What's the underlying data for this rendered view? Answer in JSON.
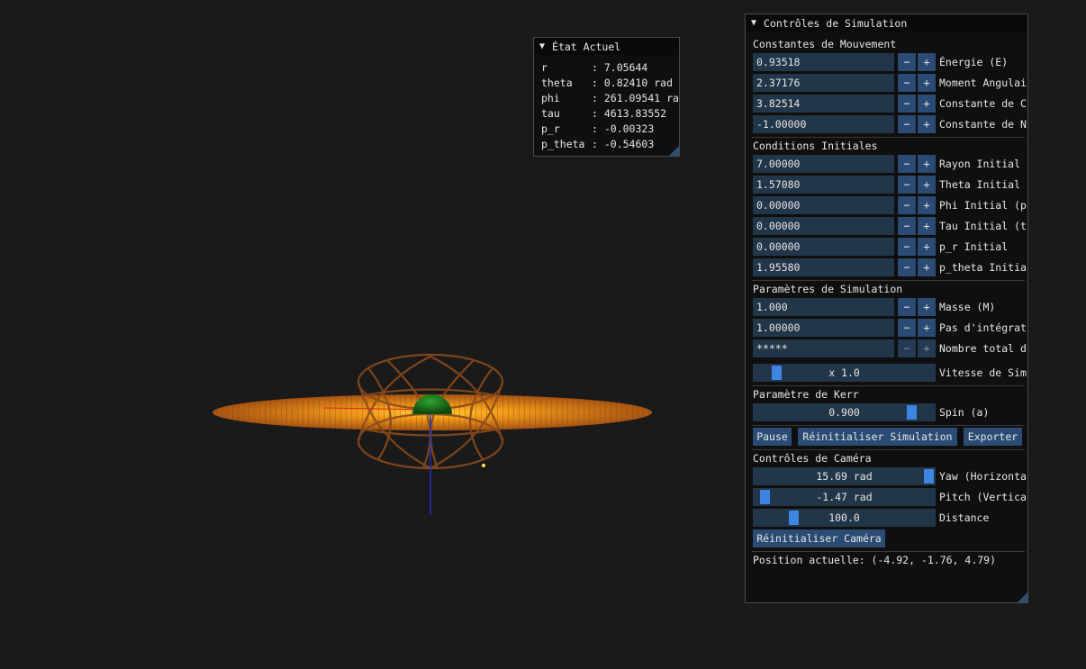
{
  "state_window": {
    "title": "État Actuel",
    "rows": [
      {
        "key": "r",
        "value": "7.05644"
      },
      {
        "key": "theta",
        "value": "0.82410 rad"
      },
      {
        "key": "phi",
        "value": "261.09541 ra"
      },
      {
        "key": "tau",
        "value": "4613.83552"
      },
      {
        "key": "p_r",
        "value": "-0.00323"
      },
      {
        "key": "p_theta",
        "value": "-0.54603"
      }
    ]
  },
  "controls": {
    "title": "Contrôles de Simulation",
    "minus": "−",
    "plus": "+",
    "motion": {
      "title": "Constantes de Mouvement",
      "fields": [
        {
          "value": "0.93518",
          "label": "Énergie (E)"
        },
        {
          "value": "2.37176",
          "label": "Moment Angulai"
        },
        {
          "value": "3.82514",
          "label": "Constante de C"
        },
        {
          "value": "-1.00000",
          "label": "Constante de N"
        }
      ]
    },
    "initial": {
      "title": "Conditions Initiales",
      "fields": [
        {
          "value": "7.00000",
          "label": "Rayon Initial"
        },
        {
          "value": "1.57080",
          "label": "Theta Initial"
        },
        {
          "value": "0.00000",
          "label": "Phi Initial (p"
        },
        {
          "value": "0.00000",
          "label": "Tau Initial (t"
        },
        {
          "value": "0.00000",
          "label": "p_r Initial"
        },
        {
          "value": "1.95580",
          "label": "p_theta Initia"
        }
      ]
    },
    "simulation": {
      "title": "Paramètres de Simulation",
      "fields": [
        {
          "value": "1.000",
          "label": "Masse (M)"
        },
        {
          "value": "1.00000",
          "label": "Pas d'intégrat"
        },
        {
          "value": "*****",
          "label": "Nombre total d"
        }
      ],
      "speed": {
        "value": "x 1.0",
        "label": "Vitesse de Sim",
        "level": 0.1
      }
    },
    "kerr": {
      "title": "Paramètre de Kerr",
      "spin": {
        "value": "0.900",
        "label": "Spin (a)",
        "level": 0.9
      }
    },
    "buttons": {
      "pause": "Pause",
      "reset_sim": "Réinitialiser Simulation",
      "export": "Exporter"
    },
    "camera": {
      "title": "Contrôles de Caméra",
      "yaw": {
        "value": "15.69 rad",
        "label": "Yaw (Horizonta",
        "level": 1.0
      },
      "pitch": {
        "value": "-1.47 rad",
        "label": "Pitch (Vertica",
        "level": 0.03
      },
      "distance": {
        "value": "100.0",
        "label": "Distance",
        "level": 0.2
      },
      "reset": "Réinitialiser Caméra",
      "position": "Position actuelle: (-4.92, -1.76, 4.79)"
    }
  },
  "colors": {
    "background": "#1a1a1a",
    "disk": "#e07a10",
    "orbit": "#8a4a1a",
    "black_hole": "#1f7a1f",
    "accent": "#3d85e0"
  }
}
